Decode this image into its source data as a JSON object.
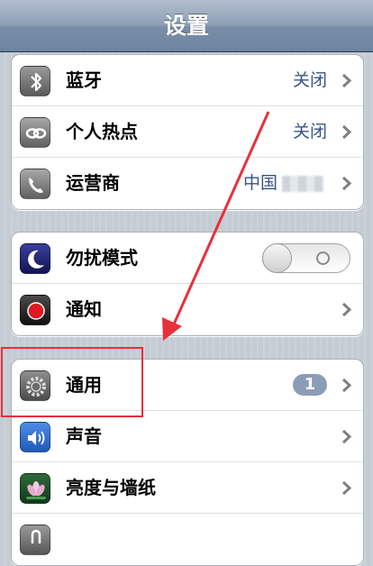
{
  "nav": {
    "title": "设置"
  },
  "group1": [
    {
      "icon": "bluetooth-icon",
      "label": "蓝牙",
      "value": "关闭"
    },
    {
      "icon": "hotspot-icon",
      "label": "个人热点",
      "value": "关闭"
    },
    {
      "icon": "phone-icon",
      "label": "运营商",
      "value": "中国"
    }
  ],
  "group2": [
    {
      "icon": "moon-icon",
      "label": "勿扰模式",
      "toggle": "off"
    },
    {
      "icon": "notification-icon",
      "label": "通知"
    }
  ],
  "group3": [
    {
      "icon": "gear-icon",
      "label": "通用",
      "badge": "1"
    },
    {
      "icon": "speaker-icon",
      "label": "声音"
    },
    {
      "icon": "lotus-icon",
      "label": "亮度与墙纸"
    },
    {
      "icon": "privacy-icon",
      "label": ""
    }
  ],
  "colors": {
    "value_text": "#385487",
    "badge": "#8a9cb8",
    "annotation": "#e8303b"
  }
}
